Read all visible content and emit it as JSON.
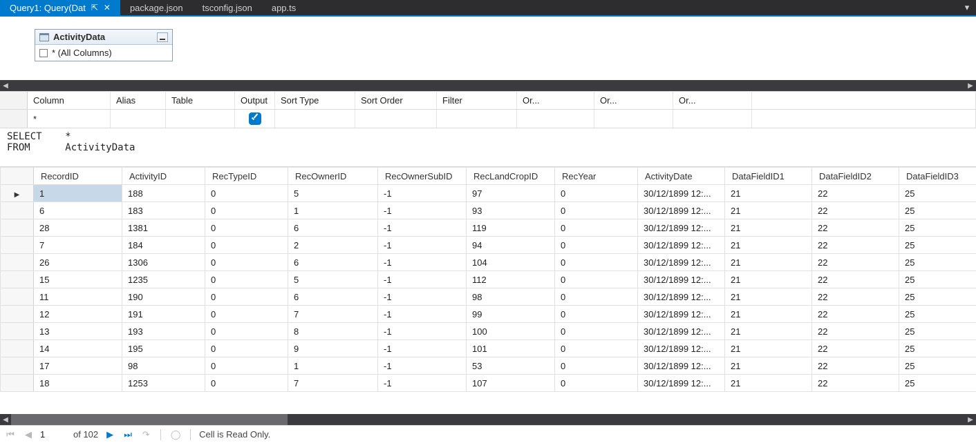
{
  "tabs": [
    {
      "label": "Query1: Query(Dat",
      "active": true,
      "pinned": true
    },
    {
      "label": "package.json",
      "active": false
    },
    {
      "label": "tsconfig.json",
      "active": false
    },
    {
      "label": "app.ts",
      "active": false
    }
  ],
  "diagram": {
    "table_name": "ActivityData",
    "all_columns_label": "* (All Columns)"
  },
  "criteria": {
    "headers": [
      "Column",
      "Alias",
      "Table",
      "Output",
      "Sort Type",
      "Sort Order",
      "Filter",
      "Or...",
      "Or...",
      "Or..."
    ],
    "row": {
      "column": "*",
      "alias": "",
      "table": "",
      "output_checked": true,
      "sort_type": "",
      "sort_order": "",
      "filter": "",
      "or1": "",
      "or2": "",
      "or3": ""
    }
  },
  "sql": {
    "line1_kw": "SELECT",
    "line1_rest": "*",
    "line2_kw": "FROM",
    "line2_rest": "ActivityData"
  },
  "results": {
    "columns": [
      "RecordID",
      "ActivityID",
      "RecTypeID",
      "RecOwnerID",
      "RecOwnerSubID",
      "RecLandCropID",
      "RecYear",
      "ActivityDate",
      "DataFieldID1",
      "DataFieldID2",
      "DataFieldID3"
    ],
    "rows": [
      [
        "1",
        "188",
        "0",
        "5",
        "-1",
        "97",
        "0",
        "30/12/1899 12:...",
        "21",
        "22",
        "25"
      ],
      [
        "6",
        "183",
        "0",
        "1",
        "-1",
        "93",
        "0",
        "30/12/1899 12:...",
        "21",
        "22",
        "25"
      ],
      [
        "28",
        "1381",
        "0",
        "6",
        "-1",
        "119",
        "0",
        "30/12/1899 12:...",
        "21",
        "22",
        "25"
      ],
      [
        "7",
        "184",
        "0",
        "2",
        "-1",
        "94",
        "0",
        "30/12/1899 12:...",
        "21",
        "22",
        "25"
      ],
      [
        "26",
        "1306",
        "0",
        "6",
        "-1",
        "104",
        "0",
        "30/12/1899 12:...",
        "21",
        "22",
        "25"
      ],
      [
        "15",
        "1235",
        "0",
        "5",
        "-1",
        "112",
        "0",
        "30/12/1899 12:...",
        "21",
        "22",
        "25"
      ],
      [
        "11",
        "190",
        "0",
        "6",
        "-1",
        "98",
        "0",
        "30/12/1899 12:...",
        "21",
        "22",
        "25"
      ],
      [
        "12",
        "191",
        "0",
        "7",
        "-1",
        "99",
        "0",
        "30/12/1899 12:...",
        "21",
        "22",
        "25"
      ],
      [
        "13",
        "193",
        "0",
        "8",
        "-1",
        "100",
        "0",
        "30/12/1899 12:...",
        "21",
        "22",
        "25"
      ],
      [
        "14",
        "195",
        "0",
        "9",
        "-1",
        "101",
        "0",
        "30/12/1899 12:...",
        "21",
        "22",
        "25"
      ],
      [
        "17",
        "98",
        "0",
        "1",
        "-1",
        "53",
        "0",
        "30/12/1899 12:...",
        "21",
        "22",
        "25"
      ],
      [
        "18",
        "1253",
        "0",
        "7",
        "-1",
        "107",
        "0",
        "30/12/1899 12:...",
        "21",
        "22",
        "25"
      ]
    ],
    "selected_row_index": 0
  },
  "nav": {
    "position": "1",
    "of_label": "of 102",
    "status": "Cell is Read Only."
  }
}
